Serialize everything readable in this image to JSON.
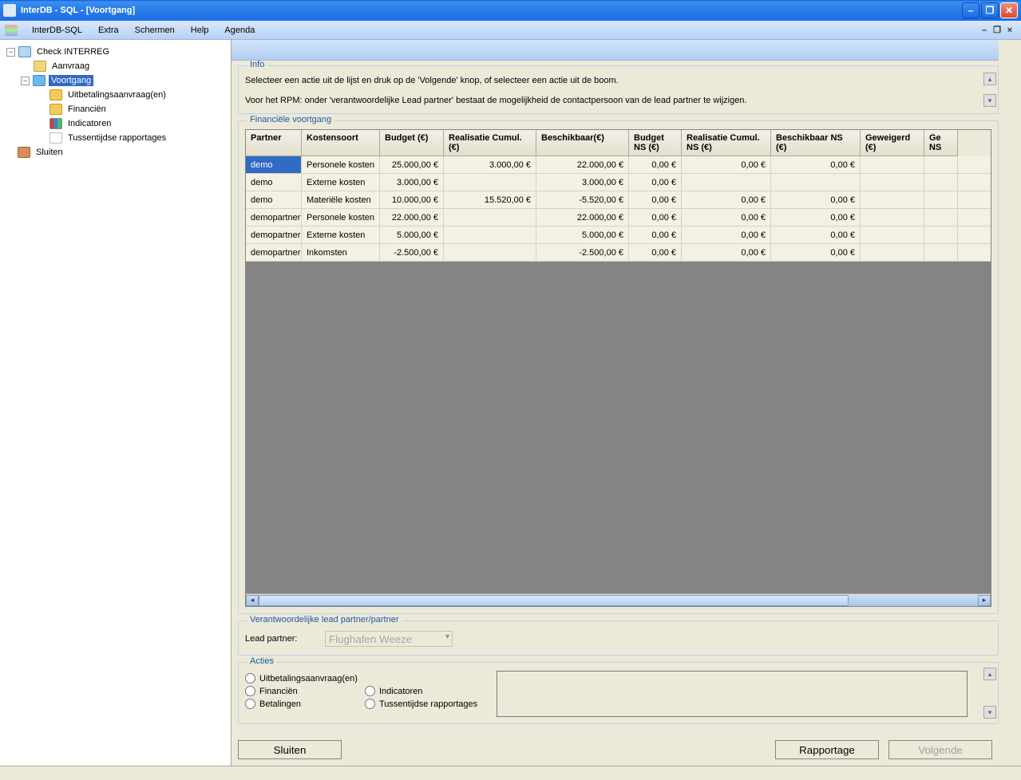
{
  "window": {
    "title": "InterDB - SQL - [Voortgang]"
  },
  "menu": {
    "items": [
      "InterDB-SQL",
      "Extra",
      "Schermen",
      "Help",
      "Agenda"
    ],
    "mdi": {
      "min": "–",
      "restore": "❐",
      "close": "×"
    }
  },
  "tree": {
    "root": "Check INTERREG",
    "aanvraag": "Aanvraag",
    "voortgang": "Voortgang",
    "children": [
      "Uitbetalingsaanvraag(en)",
      "Financiën",
      "Indicatoren",
      "Tussentijdse rapportages"
    ],
    "sluiten": "Sluiten"
  },
  "info": {
    "legend": "Info",
    "line1": "Selecteer een actie uit de lijst en druk op de 'Volgende' knop, of selecteer een actie uit de boom.",
    "line2": "Voor het RPM: onder 'verantwoordelijke Lead partner' bestaat de mogelijkheid de contactpersoon van de lead partner te wijzigen."
  },
  "grid": {
    "legend": "Financiële voortgang",
    "headers": [
      "Partner",
      "Kostensoort",
      "Budget (€)",
      "Realisatie Cumul. (€)",
      "Beschikbaar(€)",
      "Budget NS (€)",
      "Realisatie Cumul. NS (€)",
      "Beschikbaar NS (€)",
      "Geweigerd (€)",
      "Ge NS"
    ],
    "rows": [
      {
        "partner": "demo",
        "kostensoort": "Personele kosten",
        "budget": "25.000,00 €",
        "realcum": "3.000,00 €",
        "beschik": "22.000,00 €",
        "budns": "0,00 €",
        "realcumns": "0,00 €",
        "beschikns": "0,00 €",
        "gew": ""
      },
      {
        "partner": "demo",
        "kostensoort": "Externe kosten",
        "budget": "3.000,00 €",
        "realcum": "",
        "beschik": "3.000,00 €",
        "budns": "0,00 €",
        "realcumns": "",
        "beschikns": "",
        "gew": ""
      },
      {
        "partner": "demo",
        "kostensoort": "Materiële kosten",
        "budget": "10.000,00 €",
        "realcum": "15.520,00 €",
        "beschik": "-5.520,00 €",
        "budns": "0,00 €",
        "realcumns": "0,00 €",
        "beschikns": "0,00 €",
        "gew": ""
      },
      {
        "partner": "demopartner",
        "kostensoort": "Personele kosten",
        "budget": "22.000,00 €",
        "realcum": "",
        "beschik": "22.000,00 €",
        "budns": "0,00 €",
        "realcumns": "0,00 €",
        "beschikns": "0,00 €",
        "gew": ""
      },
      {
        "partner": "demopartner",
        "kostensoort": "Externe kosten",
        "budget": "5.000,00 €",
        "realcum": "",
        "beschik": "5.000,00 €",
        "budns": "0,00 €",
        "realcumns": "0,00 €",
        "beschikns": "0,00 €",
        "gew": ""
      },
      {
        "partner": "demopartner",
        "kostensoort": "Inkomsten",
        "budget": "-2.500,00 €",
        "realcum": "",
        "beschik": "-2.500,00 €",
        "budns": "0,00 €",
        "realcumns": "0,00 €",
        "beschikns": "0,00 €",
        "gew": ""
      }
    ]
  },
  "leadpartner": {
    "legend": "Verantwoordelijke lead partner/partner",
    "label": "Lead partner:",
    "value": "Flughafen Weeze"
  },
  "acties": {
    "legend": "Acties",
    "options": [
      "Uitbetalingsaanvraag(en)",
      "Financiën",
      "Betalingen",
      "Indicatoren",
      "Tussentijdse rapportages"
    ]
  },
  "buttons": {
    "sluiten": "Sluiten",
    "rapportage": "Rapportage",
    "volgende": "Volgende"
  }
}
